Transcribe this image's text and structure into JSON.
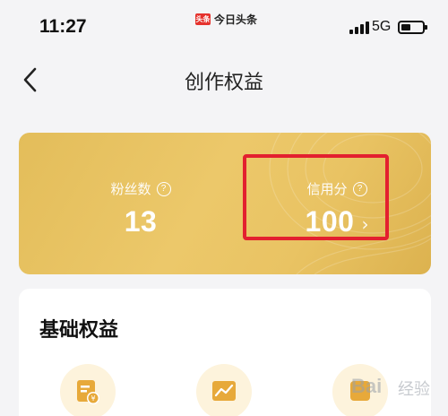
{
  "status_bar": {
    "time": "11:27",
    "app_logo_text": "头条",
    "app_name": "今日头条",
    "network": "5G"
  },
  "nav": {
    "back_icon": "chevron-left-icon",
    "title": "创作权益"
  },
  "rights_card": {
    "fans": {
      "label": "粉丝数",
      "value": "13",
      "help_icon": "question-circle-icon"
    },
    "credit": {
      "label": "信用分",
      "value": "100",
      "arrow": "›",
      "help_icon": "question-circle-icon"
    },
    "highlight_color": "#e3202f"
  },
  "basic_rights": {
    "title": "基础权益",
    "icons": [
      "yuan-document-icon",
      "line-chart-icon",
      "feature-icon"
    ]
  },
  "watermark": {
    "text_latin": "Bai",
    "text_cn": "经验"
  },
  "colors": {
    "card_gold": "#e7c15f",
    "page_bg": "#f4f4f6",
    "icon_bg": "#fdf3dc",
    "icon_accent": "#e7a93a"
  }
}
